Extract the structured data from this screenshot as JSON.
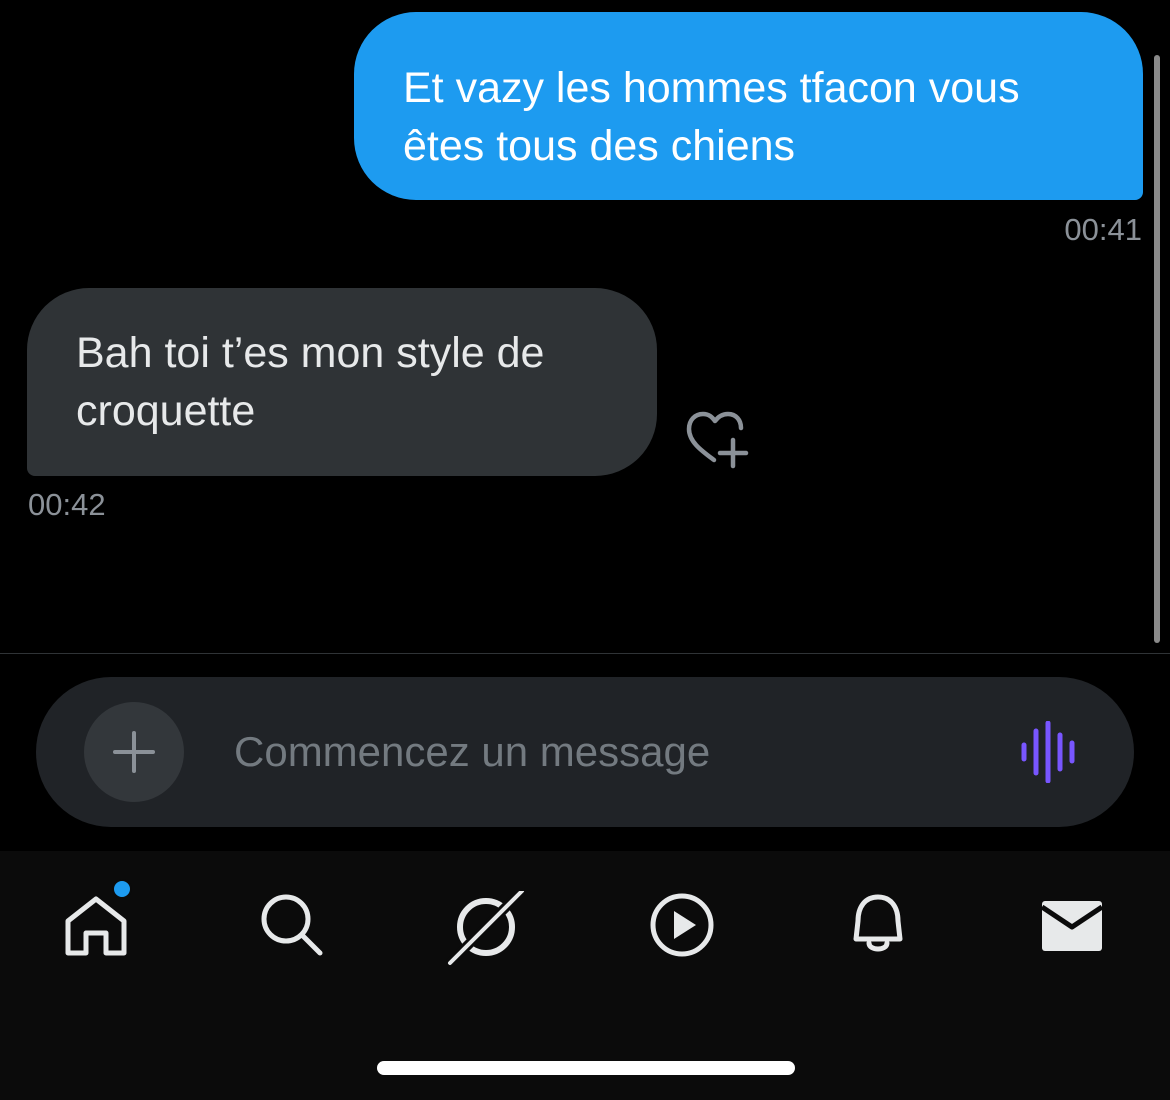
{
  "messages": [
    {
      "direction": "outgoing",
      "text_line1": "Et vazy les hommes tfacon vous",
      "text_line2": "êtes tous des chiens",
      "time": "00:41"
    },
    {
      "direction": "incoming",
      "text_line1": "Bah toi t’es mon style de",
      "text_line2": "croquette",
      "time": "00:42",
      "reaction_icon": "heart-add-icon"
    }
  ],
  "composer": {
    "placeholder": "Commencez un message",
    "value": "",
    "add_icon": "plus-icon",
    "voice_icon": "voice-waveform-icon"
  },
  "tabbar": {
    "items": [
      {
        "icon": "home-icon",
        "has_notification_dot": true
      },
      {
        "icon": "search-icon"
      },
      {
        "icon": "grok-icon"
      },
      {
        "icon": "play-icon"
      },
      {
        "icon": "bell-icon"
      },
      {
        "icon": "mail-icon"
      }
    ]
  },
  "colors": {
    "background": "#000000",
    "outgoing_bubble": "#1d9bf0",
    "incoming_bubble": "#2f3336",
    "accent_voice": "#7856ff",
    "timestamp": "#8b9198"
  }
}
